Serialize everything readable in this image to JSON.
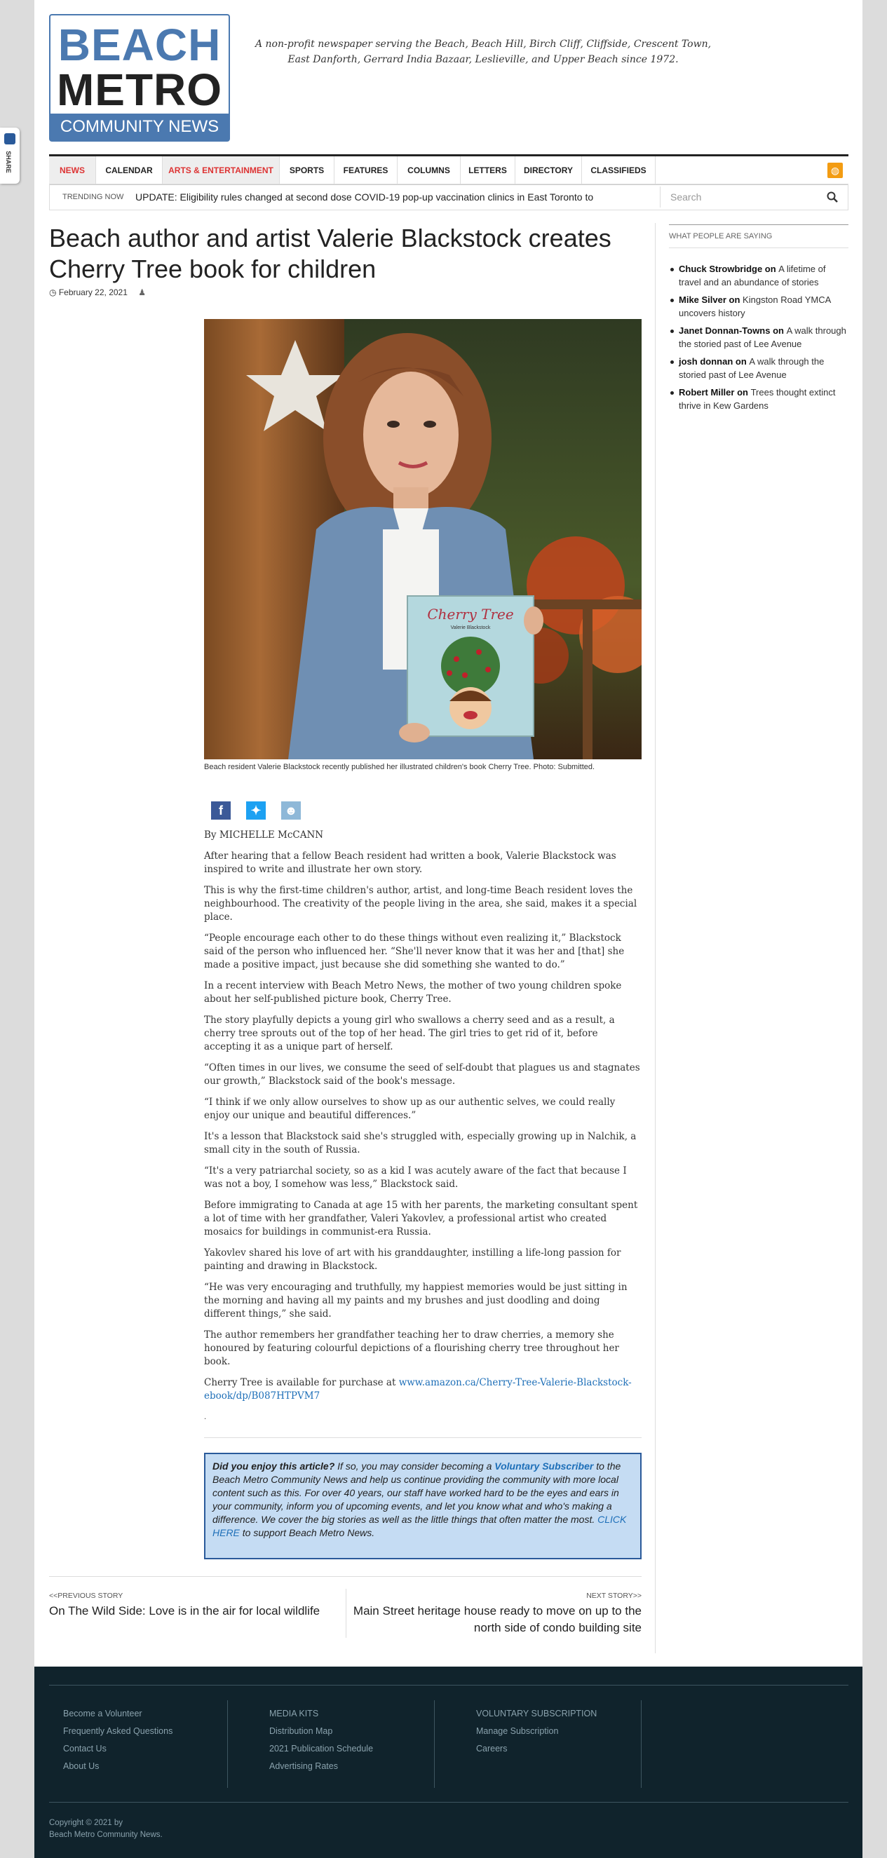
{
  "share_tab": {
    "label": "SHARE"
  },
  "logo": {
    "line1": "BEACH",
    "line2": "METRO",
    "line3": "COMMUNITY NEWS"
  },
  "tagline": "A non-profit newspaper serving the Beach, Beach Hill, Birch Cliff, Cliffside, Crescent Town, East Danforth, Gerrard India Bazaar, Leslieville, and Upper Beach since 1972.",
  "nav": {
    "items": [
      "NEWS",
      "CALENDAR",
      "ARTS & ENTERTAINMENT",
      "SPORTS",
      "FEATURES",
      "COLUMNS",
      "LETTERS",
      "DIRECTORY",
      "CLASSIFIEDS"
    ]
  },
  "trending": {
    "label": "TRENDING NOW",
    "text": "UPDATE: Eligibility rules changed at second dose COVID-19 pop-up vaccination clinics in East Toronto to"
  },
  "search": {
    "placeholder": "Search"
  },
  "article": {
    "title": "Beach author and artist Valerie Blackstock creates Cherry Tree book for children",
    "date": "February 22, 2021",
    "photo_book_title": "Cherry Tree",
    "photo_book_author": "Valerie Blackstock",
    "caption": "Beach resident Valerie Blackstock recently published her illustrated children's book Cherry Tree. Photo: Submitted.",
    "byline": "By MICHELLE McCANN",
    "paragraphs": [
      "After hearing that a fellow Beach resident had written a book, Valerie Blackstock was inspired to write and illustrate her own story.",
      "This is why the first-time children's author, artist, and long-time Beach resident loves the neighbourhood. The creativity of the people living in the area, she said, makes it a special place.",
      "“People encourage each other to do these things without even realizing it,” Blackstock said of the person who influenced her. “She'll never know that it was her and [that] she made a positive impact, just because she did something she wanted to do.”",
      "In a recent interview with Beach Metro News, the mother of two young children spoke about her self-published picture book, Cherry Tree.",
      "The story playfully depicts a young girl who swallows a cherry seed and as a result, a cherry tree sprouts out of the top of her head. The girl tries to get rid of it, before accepting it as a unique part of herself.",
      "“Often times in our lives, we consume the seed of self-doubt that plagues us and stagnates our growth,” Blackstock said of the book's message.",
      "“I think if we only allow ourselves to show up as our authentic selves, we could really enjoy our unique and beautiful differences.”",
      "It's a lesson that Blackstock said she's struggled with, especially growing up in Nalchik, a small city in the south of Russia.",
      "“It's a very patriarchal society, so as a kid I was acutely aware of the fact that because I was not a boy, I somehow was less,” Blackstock said.",
      "Before immigrating to Canada at age 15 with her parents, the marketing consultant spent a lot of time with her grandfather, Valeri Yakovlev, a professional artist who created mosaics for buildings in communist-era Russia.",
      "Yakovlev shared his love of art with his granddaughter, instilling a life-long passion for painting and drawing in Blackstock.",
      "“He was very encouraging and truthfully, my happiest memories would be just sitting in the morning and having all my paints and my brushes and just doodling and doing different things,” she said.",
      "The author remembers her grandfather teaching her to draw cherries, a memory she honoured by featuring colourful depictions of a flourishing cherry tree throughout her book."
    ],
    "purchase_prefix": "Cherry Tree is available for purchase at ",
    "purchase_link": "www.amazon.ca/Cherry-Tree-Valerie-Blackstock-ebook/dp/B087HTPVM7",
    "trailing_dot": "."
  },
  "donate": {
    "q": "Did you enjoy this article?",
    "t1": " If so, you may consider becoming a ",
    "link1": "Voluntary Subscriber",
    "t2": " to the Beach Metro Community News and help us continue providing the community with more local content such as this. For over 40 years, our staff have worked hard to be the eyes and ears in your community, inform you of upcoming events, and let you know what and who's making a difference. We cover the big stories as well as the little things that often matter the most. ",
    "link2": "CLICK HERE",
    "t3": " to support Beach Metro News."
  },
  "prev_story": {
    "label": "<<PREVIOUS STORY",
    "title": "On The Wild Side: Love is in the air for local wildlife"
  },
  "next_story": {
    "label": "NEXT STORY>>",
    "title": "Main Street heritage house ready to move on up to the north side of condo building site"
  },
  "sidebar": {
    "heading": "WHAT PEOPLE ARE SAYING",
    "comments": [
      {
        "author": "Chuck Strowbridge",
        "on": " on ",
        "post": "A lifetime of travel and an abundance of stories"
      },
      {
        "author": "Mike Silver",
        "on": " on ",
        "post": "Kingston Road YMCA uncovers history"
      },
      {
        "author": "Janet Donnan-Towns",
        "on": " on ",
        "post": "A walk through the storied past of Lee Avenue"
      },
      {
        "author": "josh donnan",
        "on": " on ",
        "post": "A walk through the storied past of Lee Avenue"
      },
      {
        "author": "Robert Miller",
        "on": " on ",
        "post": "Trees thought extinct thrive in Kew Gardens"
      }
    ]
  },
  "footer": {
    "col1": [
      "Become a Volunteer",
      "Frequently Asked Questions",
      "Contact Us",
      "About Us"
    ],
    "col2": [
      "MEDIA KITS",
      "Distribution Map",
      "2021 Publication Schedule",
      "Advertising Rates"
    ],
    "col3": [
      "VOLUNTARY SUBSCRIPTION",
      "Manage Subscription",
      "Careers"
    ],
    "copyright_line1": "Copyright © 2021 by",
    "copyright_line2": "Beach Metro Community News."
  },
  "colors": {
    "brand_blue": "#4b79b0",
    "nav_red": "#d33333",
    "footer_bg": "#10232c",
    "donate_bg": "#c5dcf3"
  }
}
